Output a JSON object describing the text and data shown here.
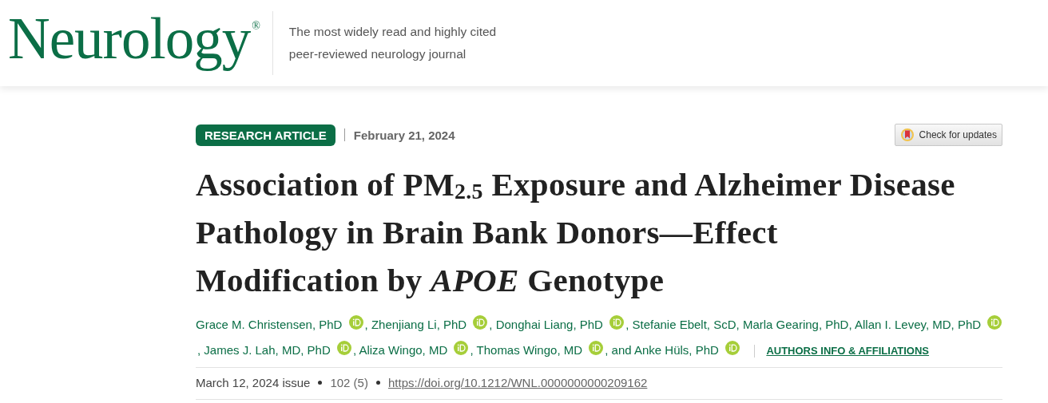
{
  "header": {
    "logo": "Neurology",
    "logo_mark": "®",
    "tagline_lines": [
      "The most widely read and highly cited",
      "peer-reviewed neurology journal"
    ]
  },
  "article": {
    "type_badge": "RESEARCH ARTICLE",
    "date": "February 21, 2024",
    "updates_button": "Check for updates",
    "title": "Association of PM$_{2.5}$ Exposure and Alzheimer Disease Pathology in Brain Bank Donors—Effect Modification by *APOE* Genotype",
    "authors": [
      {
        "name": "Grace M. Christensen, PhD",
        "orcid": true
      },
      {
        "separator": ",",
        "name": "Zhenjiang Li, PhD",
        "orcid": true
      },
      {
        "separator": ",",
        "name": "Donghai Liang, PhD",
        "orcid": true
      },
      {
        "separator": ",",
        "name": "Stefanie Ebelt, ScD,",
        "orcid": false
      },
      {
        "name": "Marla Gearing, PhD,",
        "orcid": false
      },
      {
        "name": "Allan I. Levey, MD, PhD",
        "orcid": true
      },
      {
        "separator": ",",
        "name": "James J. Lah, MD, PhD",
        "orcid": true
      },
      {
        "separator": ",",
        "name": "Aliza Wingo, MD",
        "orcid": true
      },
      {
        "separator": ",",
        "name": "Thomas Wingo, MD",
        "orcid": true
      },
      {
        "separator": ", and",
        "name": "Anke Hüls, PhD",
        "orcid": true
      }
    ],
    "affiliations_link": "AUTHORS INFO & AFFILIATIONS",
    "issue": "March 12, 2024 issue",
    "volume": "102 (5)",
    "doi": "https://doi.org/10.1212/WNL.0000000000209162"
  }
}
